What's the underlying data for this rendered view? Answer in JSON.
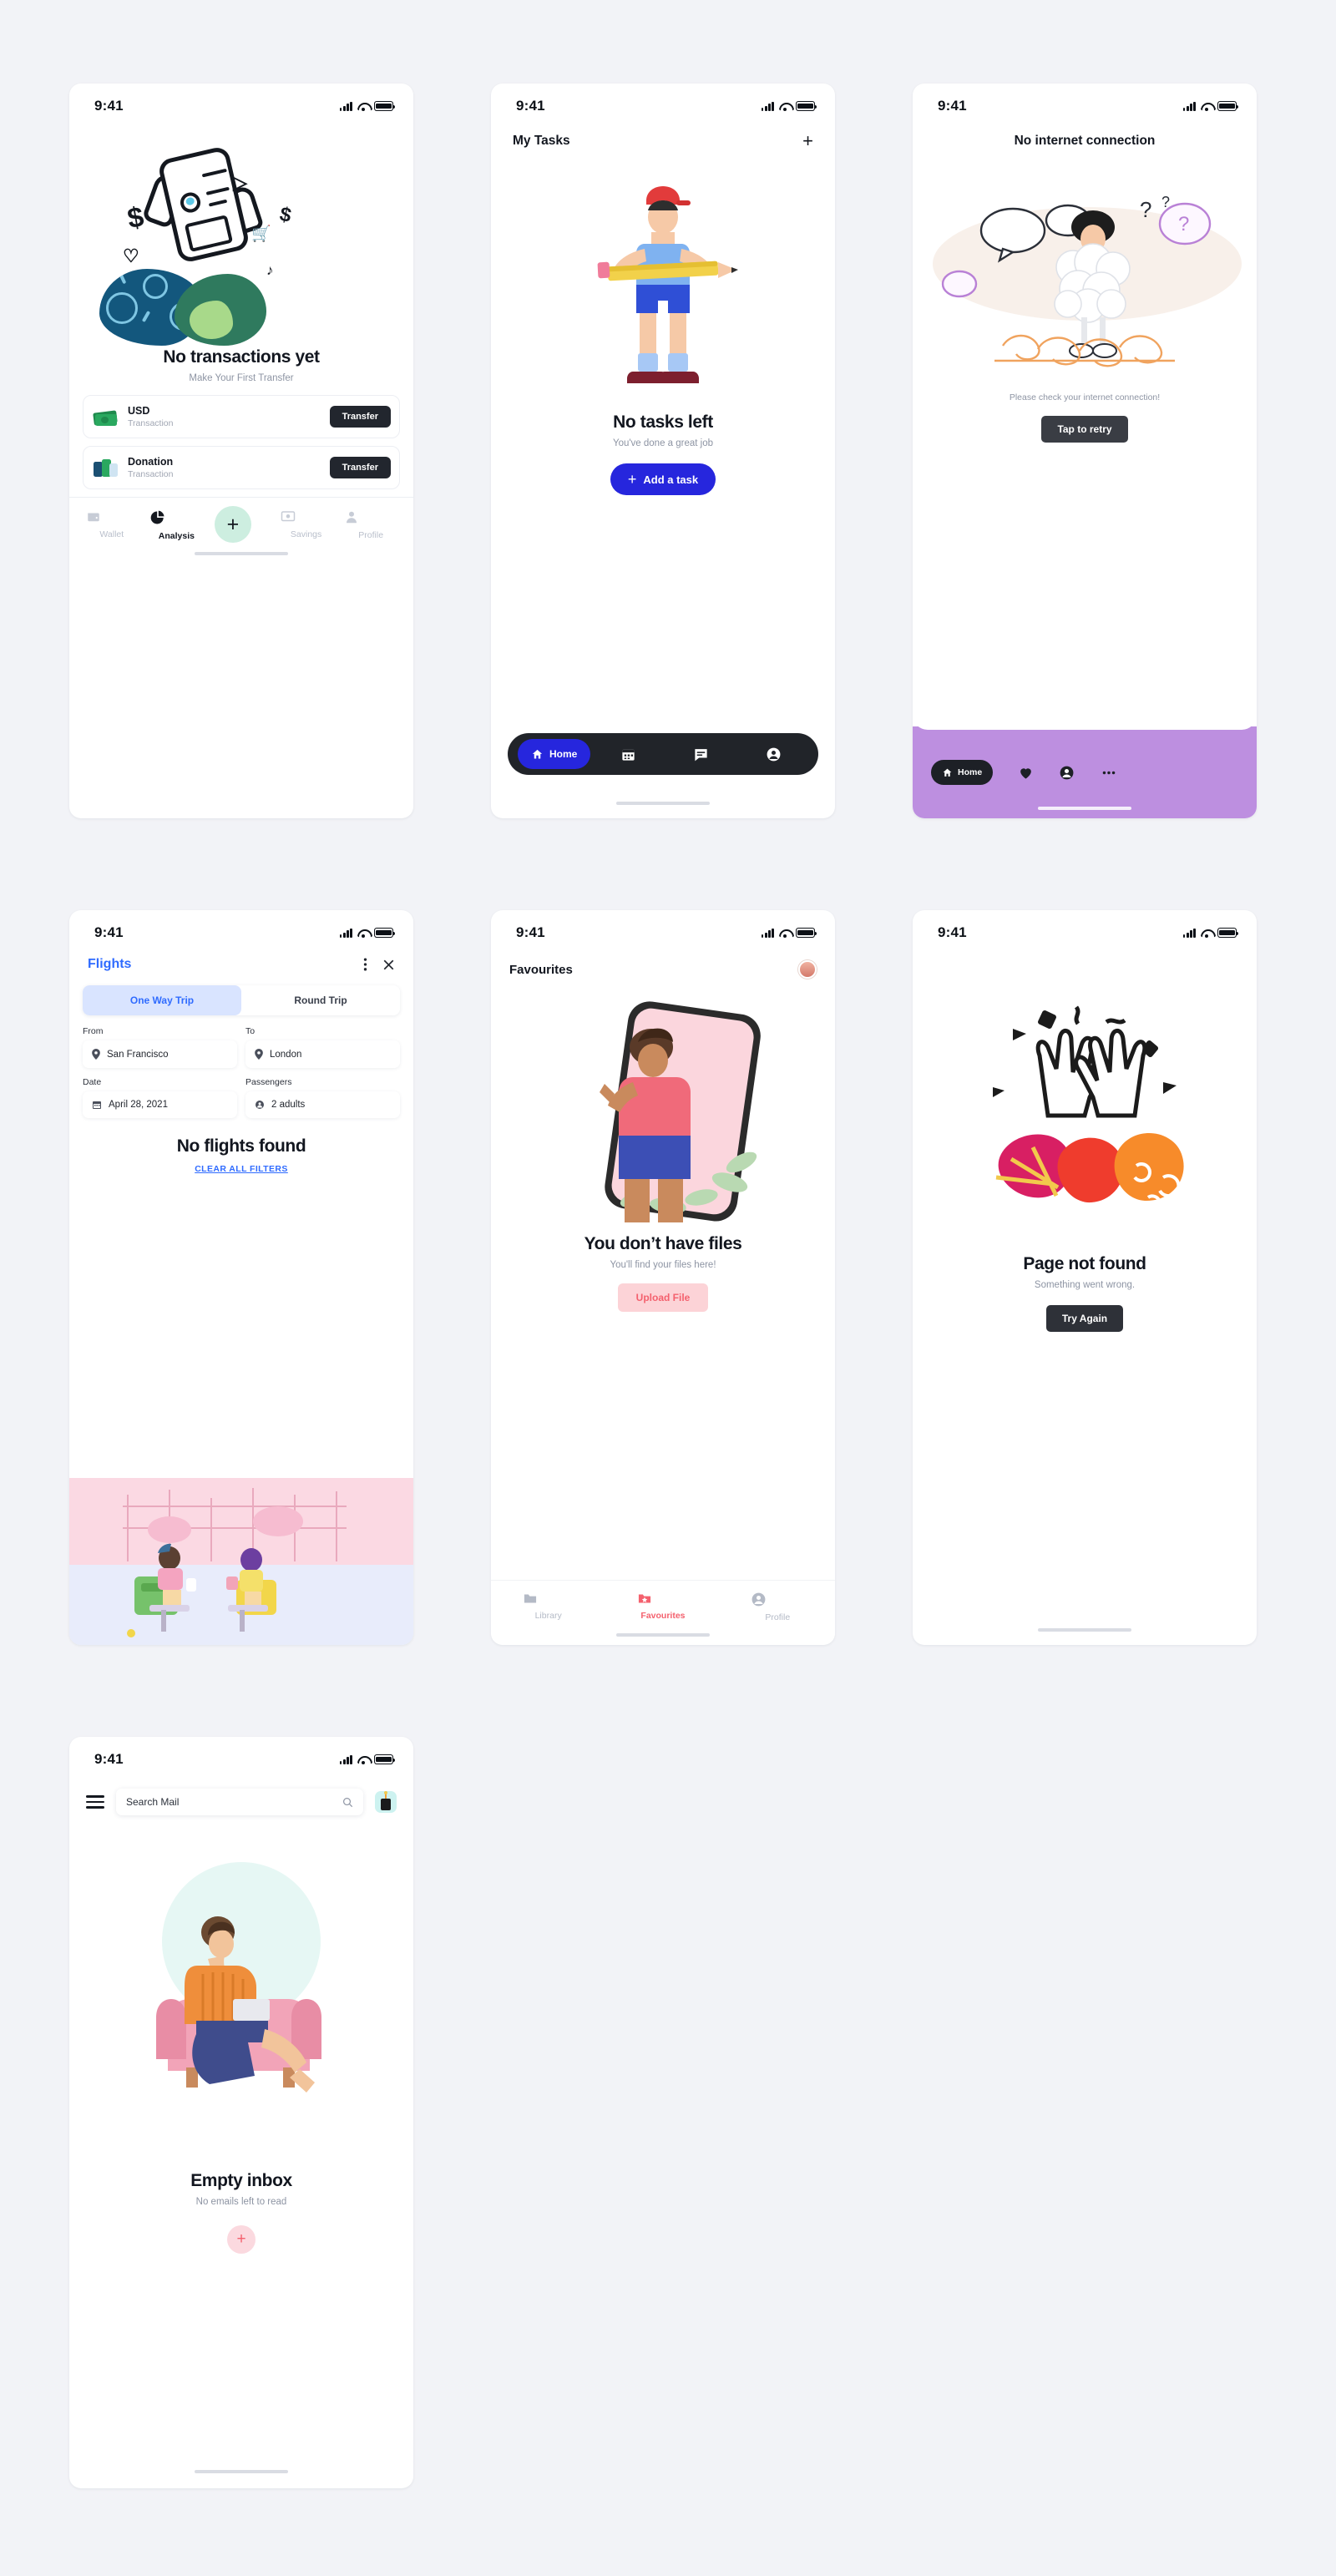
{
  "status_bar": {
    "time": "9:41",
    "signal_icon": "cellular-bars-icon",
    "wifi_icon": "wifi-icon",
    "battery_icon": "battery-icon"
  },
  "screens": {
    "wallet": {
      "name": "no-transactions",
      "title": "No transactions yet",
      "subtitle": "Make Your First Transfer",
      "transactions": [
        {
          "name": "USD",
          "sub": "Transaction",
          "action": "Transfer",
          "icon": "cash-stack-icon"
        },
        {
          "name": "Donation",
          "sub": "Transaction",
          "action": "Transfer",
          "icon": "donation-box-icon"
        }
      ],
      "nav": [
        {
          "label": "Wallet",
          "icon": "wallet-icon",
          "active": false
        },
        {
          "label": "Analysis",
          "icon": "pie-chart-icon",
          "active": true
        },
        {
          "label": "",
          "icon": "plus-icon",
          "active": false,
          "fab": true
        },
        {
          "label": "Savings",
          "icon": "safe-box-icon",
          "active": false
        },
        {
          "label": "Profile",
          "icon": "person-icon",
          "active": false
        }
      ]
    },
    "tasks": {
      "name": "no-tasks-left",
      "header": "My Tasks",
      "add_icon": "plus-icon",
      "title": "No tasks left",
      "subtitle": "You've done a great job",
      "cta": "Add a task",
      "cta_icon": "plus-icon",
      "accent": "#2626dd",
      "nav": [
        {
          "label": "Home",
          "icon": "home-icon",
          "active": true
        },
        {
          "label": "",
          "icon": "calendar-icon",
          "active": false
        },
        {
          "label": "",
          "icon": "chat-icon",
          "active": false
        },
        {
          "label": "",
          "icon": "account-circle-icon",
          "active": false
        }
      ]
    },
    "offline": {
      "name": "no-internet-connection",
      "title": "No internet connection",
      "hint": "Please check your internet connection!",
      "cta": "Tap to retry",
      "footer_color": "#bd8fe0",
      "nav": [
        {
          "label": "Home",
          "icon": "home-icon",
          "active": true
        },
        {
          "label": "",
          "icon": "heart-icon",
          "active": false
        },
        {
          "label": "",
          "icon": "account-circle-icon",
          "active": false
        },
        {
          "label": "",
          "icon": "more-horizontal-icon",
          "active": false
        }
      ]
    },
    "flights": {
      "name": "no-flights-found",
      "header": "Flights",
      "accent": "#2f6bff",
      "menu_icon": "more-vertical-icon",
      "close_icon": "close-icon",
      "tabs": [
        {
          "label": "One Way Trip",
          "active": true
        },
        {
          "label": "Round Trip",
          "active": false
        }
      ],
      "fields": [
        {
          "label": "From",
          "value": "San Francisco",
          "icon": "location-pin-icon"
        },
        {
          "label": "To",
          "value": "London",
          "icon": "location-pin-icon"
        },
        {
          "label": "Date",
          "value": "April 28, 2021",
          "icon": "calendar-icon"
        },
        {
          "label": "Passengers",
          "value": "2 adults",
          "icon": "person-icon"
        }
      ],
      "title": "No flights found",
      "clear_link": "CLEAR ALL FILTERS"
    },
    "files": {
      "name": "no-files",
      "header": "Favourites",
      "avatar_icon": "user-avatar-icon",
      "title": "You don’t have files",
      "subtitle": "You'll find your files here!",
      "cta": "Upload File",
      "accent": "#f4616e",
      "nav": [
        {
          "label": "Library",
          "icon": "folder-icon",
          "active": false
        },
        {
          "label": "Favourites",
          "icon": "folder-star-icon",
          "active": true
        },
        {
          "label": "Profile",
          "icon": "account-circle-icon",
          "active": false
        }
      ]
    },
    "notfound": {
      "name": "page-not-found",
      "title": "Page not found",
      "subtitle": "Something went wrong.",
      "cta": "Try Again"
    },
    "mail": {
      "name": "empty-inbox",
      "menu_icon": "hamburger-menu-icon",
      "search_placeholder": "Search Mail",
      "search_icon": "search-icon",
      "app_icon": "mail-app-icon",
      "title": "Empty inbox",
      "subtitle": "No emails left to read",
      "fab_icon": "plus-icon",
      "accent": "#f4616e"
    }
  }
}
